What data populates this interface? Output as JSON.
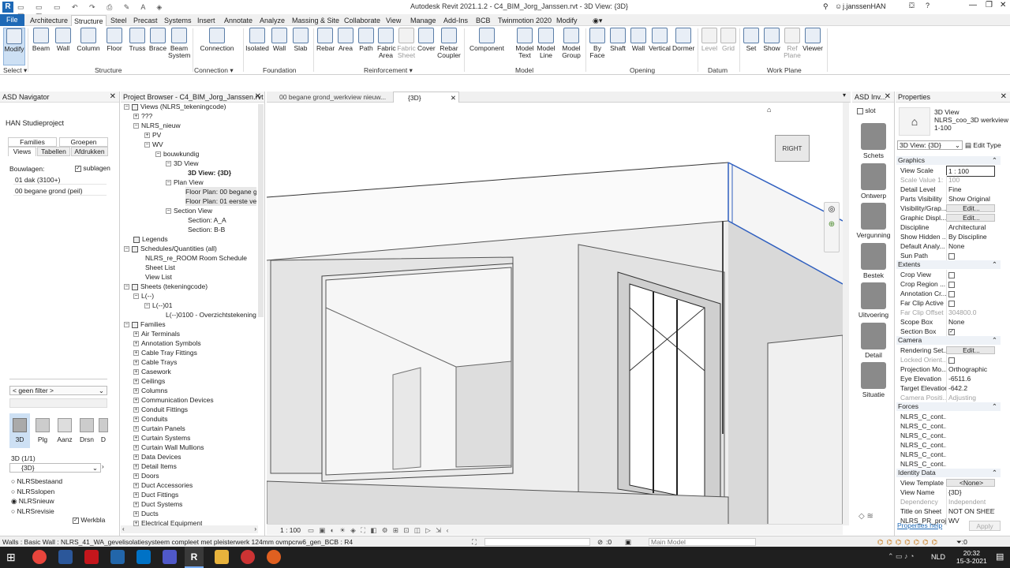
{
  "window_title": "Autodesk Revit 2021.1.2 - C4_BIM_Jorg_Janssen.rvt - 3D View: {3D}",
  "user": "j.janssenHAN",
  "menu_tabs": [
    "File",
    "Architecture",
    "Structure",
    "Steel",
    "Precast",
    "Systems",
    "Insert",
    "Annotate",
    "Analyze",
    "Massing & Site",
    "Collaborate",
    "View",
    "Manage",
    "Add-Ins",
    "BCB",
    "Twinmotion 2020",
    "Modify"
  ],
  "active_tab": "Structure",
  "ribbon": {
    "select": {
      "modify": "Modify",
      "label": "Select ▾"
    },
    "structure": [
      "Beam",
      "Wall",
      "Column",
      "Floor",
      "Truss",
      "Brace",
      "Beam System"
    ],
    "structure_label": "Structure",
    "connection": "Connection",
    "connection_label": "Connection ▾",
    "foundation": [
      "Isolated",
      "Wall",
      "Slab"
    ],
    "foundation_label": "Foundation",
    "reinforcement": [
      "Rebar",
      "Area",
      "Path",
      "Fabric Area",
      "Fabric Sheet",
      "Cover",
      "Rebar Coupler"
    ],
    "reinforcement_label": "Reinforcement ▾",
    "model": [
      "Component",
      "Model Text",
      "Model Line",
      "Model Group"
    ],
    "model_label": "Model",
    "opening": [
      "By Face",
      "Shaft",
      "Wall",
      "Vertical",
      "Dormer"
    ],
    "opening_label": "Opening",
    "datum": [
      "Level",
      "Grid"
    ],
    "datum_label": "Datum",
    "workplane": [
      "Set",
      "Show",
      "Ref Plane",
      "Viewer"
    ],
    "workplane_label": "Work Plane"
  },
  "asd_navigator": {
    "title": "ASD Navigator",
    "project": "HAN Studieproject",
    "tabs_top": [
      "Families",
      "Groepen"
    ],
    "tabs": [
      "Views",
      "Tabellen",
      "Afdrukken"
    ],
    "bouwlagen_label": "Bouwlagen:",
    "sublagen_label": "sublagen",
    "levels": [
      "01 dak (3100+)",
      "00 begane grond (peil)"
    ],
    "filter": "< geen filter >",
    "view_icons": [
      "3D",
      "Plg",
      "Aanz",
      "Drsn",
      "D"
    ],
    "view_count": "3D (1/1)",
    "view_select": "{3D}",
    "radios": [
      "NLRSbestaand",
      "NLRSslopen",
      "NLRSnieuw",
      "NLRSrevisie"
    ],
    "werkbla": "Werkbla"
  },
  "project_browser": {
    "title": "Project Browser - C4_BIM_Jorg_Janssen.rvt",
    "views_root": "Views (NLRS_tekeningcode)",
    "tree": [
      "???",
      "NLRS_nieuw",
      "PV",
      "WV",
      "bouwkundig",
      "3D View",
      "3D View: {3D}",
      "Plan View",
      "Floor Plan: 00 begane gr",
      "Floor Plan: 01 eerste verd",
      "Section View",
      "Section: A_A",
      "Section: B-B"
    ],
    "legends": "Legends",
    "schedules": "Schedules/Quantities (all)",
    "schedule_items": [
      "NLRS_re_ROOM Room Schedule",
      "Sheet List",
      "View List"
    ],
    "sheets": "Sheets (tekeningcode)",
    "sheet_items": [
      "L(--)",
      "L(--)01",
      "L(--)0100 - Overzichtstekening"
    ],
    "families": "Families",
    "family_items": [
      "Air Terminals",
      "Annotation Symbols",
      "Cable Tray Fittings",
      "Cable Trays",
      "Casework",
      "Ceilings",
      "Columns",
      "Communication Devices",
      "Conduit Fittings",
      "Conduits",
      "Curtain Panels",
      "Curtain Systems",
      "Curtain Wall Mullions",
      "Data Devices",
      "Detail Items",
      "Doors",
      "Duct Accessories",
      "Duct Fittings",
      "Duct Systems",
      "Ducts",
      "Electrical Equipment"
    ]
  },
  "doc_tabs": [
    "00 begane grond_werkview nieuw...",
    "{3D}"
  ],
  "viewcube_label": "RIGHT",
  "view_scale": "1 : 100",
  "asd_inv": {
    "title": "ASD Inv...",
    "slot": "slot",
    "items": [
      "Schets",
      "Ontwerp",
      "Vergunning",
      "Bestek",
      "Uitvoering",
      "Detail",
      "Situatie"
    ]
  },
  "properties": {
    "title": "Properties",
    "type_line1": "3D View",
    "type_line2": "NLRS_coo_3D werkview",
    "type_line3": "1-100",
    "selector": "3D View: {3D}",
    "edit_type": "Edit Type",
    "graphics_header": "Graphics",
    "graphics": [
      [
        "View Scale",
        "1 : 100"
      ],
      [
        "Scale Value  1:",
        "100"
      ],
      [
        "Detail Level",
        "Fine"
      ],
      [
        "Parts Visibility",
        "Show Original"
      ],
      [
        "Visibility/Grap...",
        "Edit..."
      ],
      [
        "Graphic Displ...",
        "Edit..."
      ],
      [
        "Discipline",
        "Architectural"
      ],
      [
        "Show Hidden ...",
        "By Discipline"
      ],
      [
        "Default Analy...",
        "None"
      ],
      [
        "Sun Path",
        ""
      ]
    ],
    "extents_header": "Extents",
    "extents": [
      [
        "Crop View",
        ""
      ],
      [
        "Crop Region ...",
        ""
      ],
      [
        "Annotation Cr...",
        ""
      ],
      [
        "Far Clip Active",
        ""
      ],
      [
        "Far Clip Offset",
        "304800.0"
      ],
      [
        "Scope Box",
        "None"
      ],
      [
        "Section Box",
        ""
      ]
    ],
    "camera_header": "Camera",
    "camera": [
      [
        "Rendering Set...",
        "Edit..."
      ],
      [
        "Locked Orient...",
        ""
      ],
      [
        "Projection Mo...",
        "Orthographic"
      ],
      [
        "Eye Elevation",
        "-6511.6"
      ],
      [
        "Target Elevation",
        "-642.2"
      ],
      [
        "Camera Positi...",
        "Adjusting"
      ]
    ],
    "forces_header": "Forces",
    "forces": [
      "NLRS_C_cont...",
      "NLRS_C_cont...",
      "NLRS_C_cont...",
      "NLRS_C_cont...",
      "NLRS_C_cont...",
      "NLRS_C_cont..."
    ],
    "identity_header": "Identity Data",
    "identity": [
      [
        "View Template",
        "<None>"
      ],
      [
        "View Name",
        "{3D}"
      ],
      [
        "Dependency",
        "Independent"
      ],
      [
        "Title on Sheet",
        "NOT ON SHEET"
      ],
      [
        "NLRS_PR_proj...",
        "WV"
      ]
    ],
    "help": "Properties help",
    "apply": "Apply"
  },
  "status": {
    "text": "Walls : Basic Wall : NLRS_41_WA_gevelisolatiesysteem compleet met pleisterwerk 124mm ovmpcrw6_gen_BCB : R4",
    "zero": ":0",
    "model": "Main Model"
  },
  "tray": {
    "lang": "NLD",
    "time": "20:32",
    "date": "15-3-2021"
  }
}
